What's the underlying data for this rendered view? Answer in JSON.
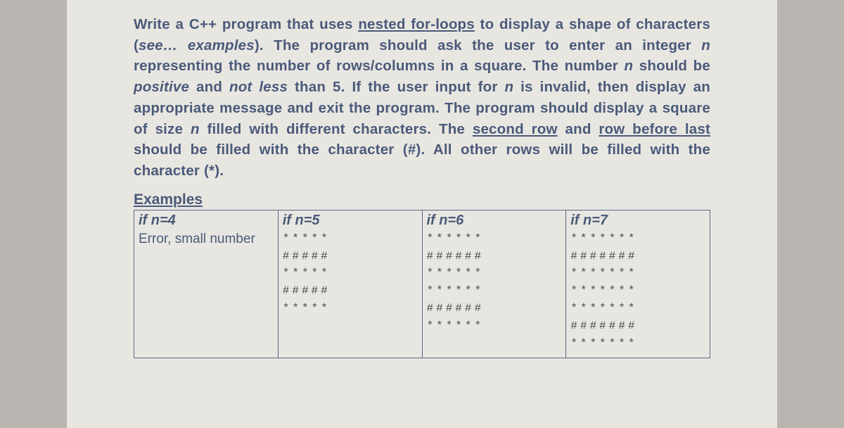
{
  "problem": {
    "seg1": "Write a C++ program that uses ",
    "seg2": "nested for-loops",
    "seg3": " to display a shape of characters (",
    "seg4": "see… examples",
    "seg5": "). The program should ask the user to enter an integer ",
    "seg6": "n",
    "seg7": " representing the number of rows/columns in a square. The number ",
    "seg8": "n",
    "seg9": " should be ",
    "seg10": "positive",
    "seg11": " and ",
    "seg12": "not less",
    "seg13": " than 5. If the user input for ",
    "seg14": "n",
    "seg15": " is invalid, then display an appropriate message and exit the program. The program should display a ",
    "seg16": "square",
    "seg17": " of size ",
    "seg18": "n",
    "seg19": " filled with different characters.  The ",
    "seg20": "second row",
    "seg21": " and ",
    "seg22": "row before last",
    "seg23": " should be filled with the character ",
    "seg24": "(#)",
    "seg25": ". All other rows will be filled with the character ",
    "seg26": "(*)",
    "seg27": "."
  },
  "examples_heading": "Examples",
  "columns": [
    {
      "head": "if n=4",
      "body_text": "Error, small number",
      "pattern": ""
    },
    {
      "head": "if n=5",
      "body_text": "",
      "pattern": "*****\n#####\n*****\n#####\n*****"
    },
    {
      "head": "if n=6",
      "body_text": "",
      "pattern": "******\n######\n******\n******\n######\n******"
    },
    {
      "head": "if n=7",
      "body_text": "",
      "pattern": "*******\n#######\n*******\n*******\n*******\n#######\n*******"
    }
  ]
}
